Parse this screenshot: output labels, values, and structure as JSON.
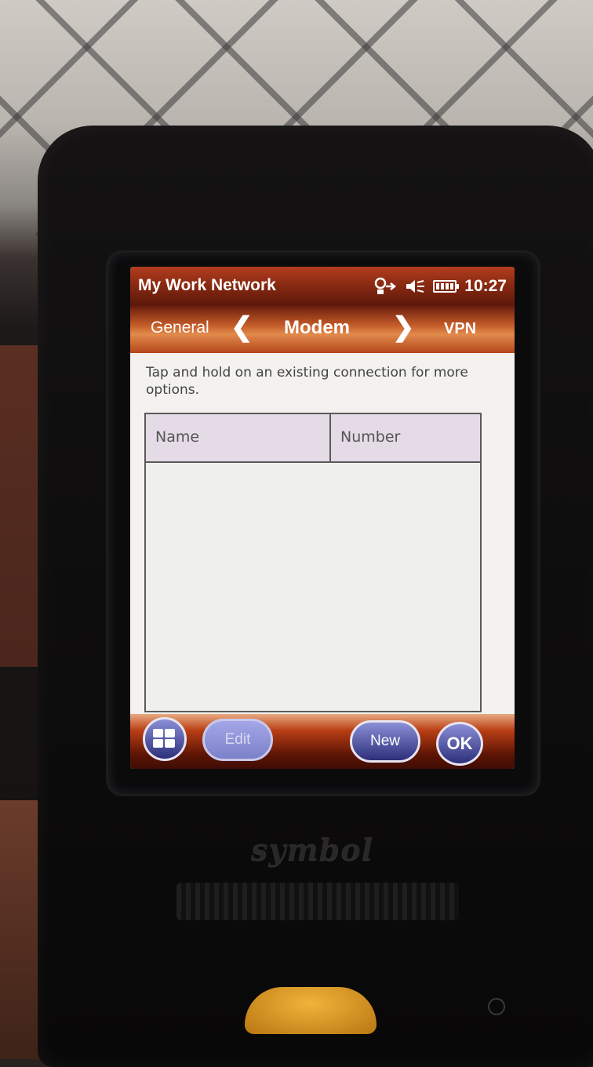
{
  "app": {
    "title": "My Work Network"
  },
  "status": {
    "clock": "10:27",
    "icons": [
      "network-connection-icon",
      "speaker-muted-icon",
      "battery-icon"
    ]
  },
  "tabs": {
    "previous": "General",
    "current": "Modem",
    "next": "VPN"
  },
  "content": {
    "hint": "Tap and hold on an existing connection for more options.",
    "list": {
      "columns": [
        "Name",
        "Number"
      ],
      "rows": []
    }
  },
  "softkeys": {
    "edit": "Edit",
    "new": "New",
    "ok": "OK"
  },
  "device": {
    "brand": "symbol"
  },
  "colors": {
    "titlebar": "#8a2a12",
    "tabbar_accent": "#c25a28",
    "button_blue": "#2d2f7a",
    "header_fill": "#e4dbe6"
  }
}
